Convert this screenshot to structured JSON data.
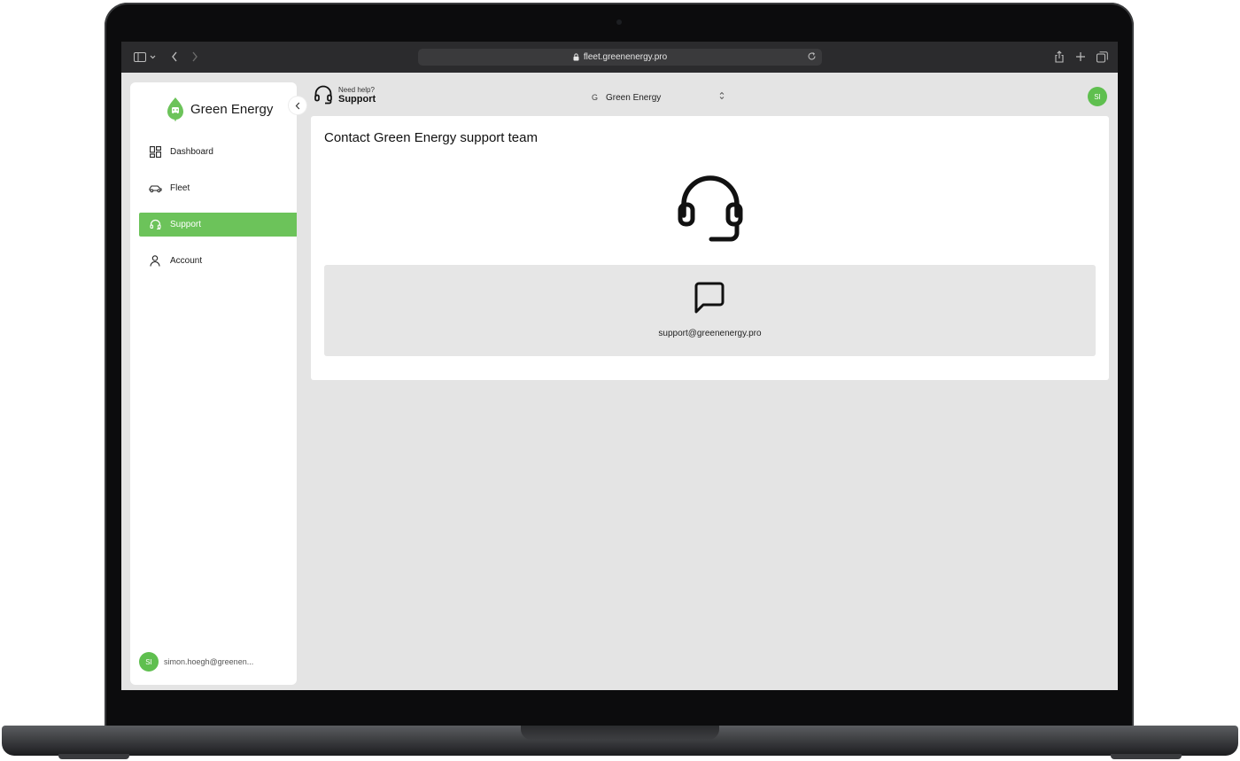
{
  "browser": {
    "url": "fleet.greenenergy.pro"
  },
  "brand": {
    "name": "Green Energy",
    "accent": "#6cc35a"
  },
  "sidebar": {
    "items": [
      {
        "label": "Dashboard",
        "icon": "dashboard-grid-icon",
        "active": false
      },
      {
        "label": "Fleet",
        "icon": "car-icon",
        "active": false
      },
      {
        "label": "Support",
        "icon": "headset-icon",
        "active": true
      },
      {
        "label": "Account",
        "icon": "user-icon",
        "active": false
      }
    ],
    "user": {
      "initials": "SI",
      "email": "simon.hoegh@greenen..."
    }
  },
  "header": {
    "help_small": "Need help?",
    "help_big": "Support",
    "org_initial": "G",
    "org_name": "Green Energy",
    "avatar_initials": "SI"
  },
  "main": {
    "title": "Contact Green Energy support team",
    "contact_email": "support@greenenergy.pro"
  }
}
